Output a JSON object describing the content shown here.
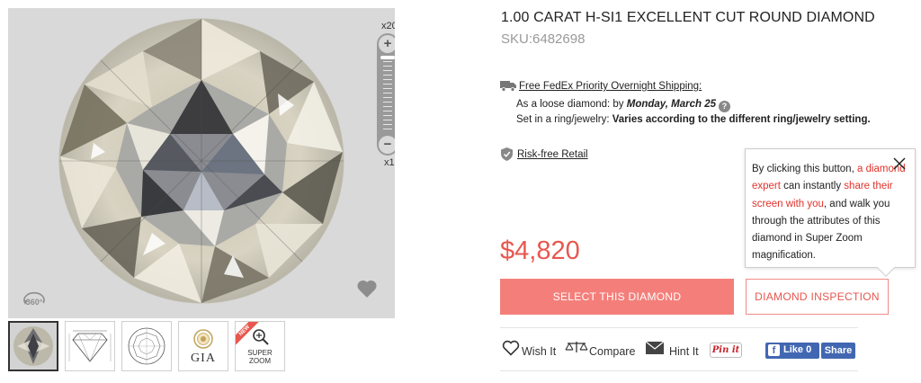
{
  "viewer": {
    "zoom_max_label": "x20",
    "zoom_min_label": "x1",
    "zoom_plus": "+",
    "zoom_minus": "−",
    "rotate_label": "360°"
  },
  "thumbnails": [
    {
      "name": "thumb-diamond-photo",
      "active": true
    },
    {
      "name": "thumb-diamond-diagram",
      "active": false
    },
    {
      "name": "thumb-diamond-plot",
      "active": false
    },
    {
      "name": "thumb-gia-certificate",
      "label": "GIA",
      "active": false
    },
    {
      "name": "thumb-super-zoom",
      "label_line1": "SUPER",
      "label_line2": "ZOOM",
      "ribbon": "NEW",
      "active": false
    }
  ],
  "product": {
    "title": "1.00 CARAT H-SI1 EXCELLENT CUT ROUND DIAMOND",
    "sku": "SKU:6482698"
  },
  "shipping": {
    "heading": "Free FedEx Priority Overnight Shipping:",
    "loose_prefix": "As a loose diamond: by ",
    "loose_date": "Monday, March 25",
    "help_icon": "?",
    "ring_prefix": "Set in a ring/jewelry: ",
    "ring_value": "Varies according to the different ring/jewelry setting."
  },
  "risk_free": {
    "label": "Risk-free Retail"
  },
  "tooltip": {
    "part1": "By clicking this button, ",
    "highlight1": "a diamond expert",
    "part2": " can instantly ",
    "highlight2": "share their screen with you",
    "part3": ", and walk you through the attributes of this diamond in Super Zoom magnification."
  },
  "price": "$4,820",
  "buttons": {
    "select": "SELECT THIS DIAMOND",
    "inspection": "DIAMOND INSPECTION"
  },
  "share_bar": {
    "wish": "Wish It",
    "compare": "Compare",
    "hint": "Hint It",
    "pinit": "Pin it",
    "fb_icon": "f",
    "fb_like": "Like 0",
    "fb_share": "Share"
  },
  "colors": {
    "accent": "#e8574f",
    "button_fill": "#f47f7a",
    "highlight_text": "#e2322b",
    "facebook": "#4267b2",
    "viewer_bg": "#d9d9d9"
  }
}
